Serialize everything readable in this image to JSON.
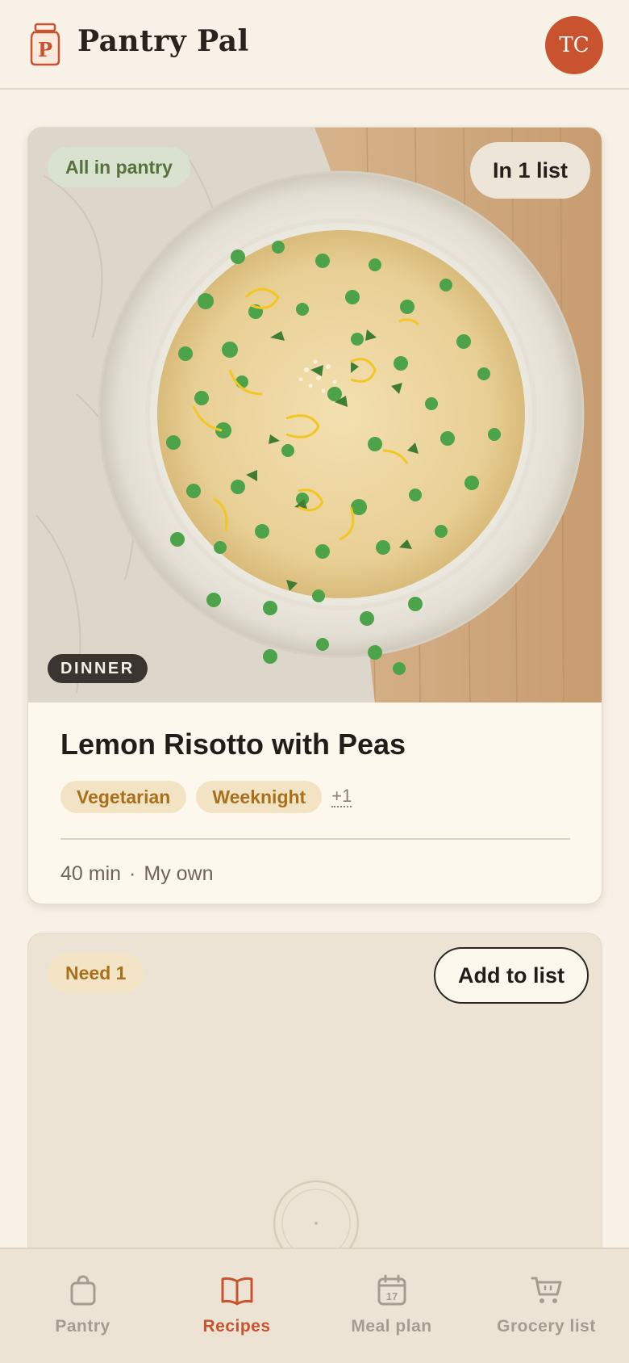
{
  "app": {
    "title": "Pantry Pal",
    "logo_letter": "P",
    "avatar_initials": "TC",
    "accent_color": "#c9532f"
  },
  "recipe_card": {
    "availability": "All in pantry",
    "list_status": "In 1 list",
    "meal_type": "DINNER",
    "title": "Lemon Risotto with Peas",
    "tags": [
      "Vegetarian",
      "Weeknight"
    ],
    "more_tags": "+1",
    "time": "40 min",
    "separator": "·",
    "source": "My own"
  },
  "second_card": {
    "need": "Need 1",
    "add_button": "Add to list"
  },
  "nav": {
    "items": [
      {
        "label": "Pantry",
        "icon": "shopping-bag-icon"
      },
      {
        "label": "Recipes",
        "icon": "open-book-icon",
        "active": true
      },
      {
        "label": "Meal plan",
        "icon": "calendar-icon",
        "date": "17"
      },
      {
        "label": "Grocery list",
        "icon": "shopping-cart-icon"
      }
    ]
  }
}
